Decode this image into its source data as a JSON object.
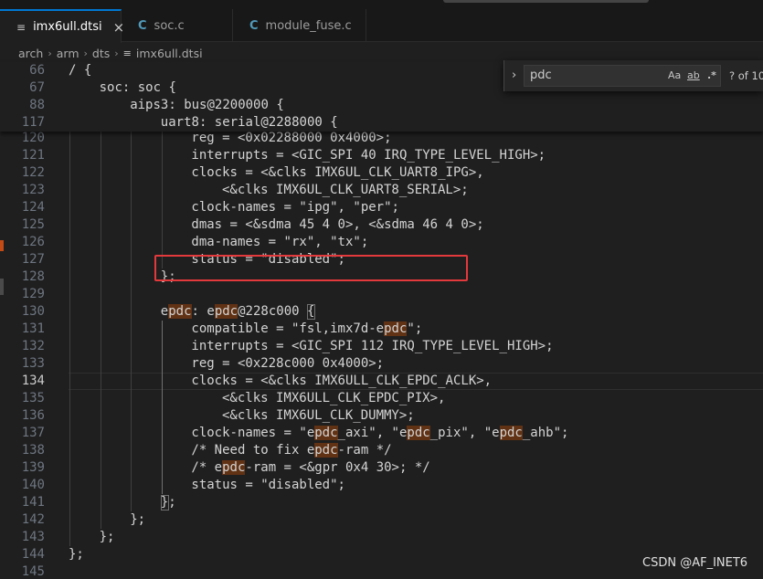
{
  "tabs": [
    {
      "label": "imx6ull.dtsi",
      "icon": "lines-icon",
      "close": "×"
    },
    {
      "label": "soc.c",
      "icon": "c-file-icon"
    },
    {
      "label": "module_fuse.c",
      "icon": "c-file-icon"
    }
  ],
  "tab_icon_c": "C",
  "tab_icon_lines": "≡",
  "breadcrumb": [
    "arch",
    "arm",
    "dts",
    "imx6ull.dtsi"
  ],
  "breadcrumb_sep": "›",
  "find": {
    "toggle": "›",
    "query": "pdc",
    "match_case": "Aa",
    "whole_word": "ab",
    "regex": ".*",
    "count": "? of 10"
  },
  "sticky": [
    {
      "n": "66",
      "indent": 0,
      "text": "/ {"
    },
    {
      "n": "67",
      "indent": 1,
      "text": "soc: soc {"
    },
    {
      "n": "88",
      "indent": 2,
      "text": "aips3: bus@2200000 {"
    },
    {
      "n": "117",
      "indent": 3,
      "text": "uart8: serial@2288000 {"
    }
  ],
  "lines": [
    {
      "n": "120",
      "indent": 4,
      "text": "reg = <0x02288000 0x4000>;"
    },
    {
      "n": "121",
      "indent": 4,
      "text": "interrupts = <GIC_SPI 40 IRQ_TYPE_LEVEL_HIGH>;"
    },
    {
      "n": "122",
      "indent": 4,
      "text": "clocks = <&clks IMX6UL_CLK_UART8_IPG>,"
    },
    {
      "n": "123",
      "indent": 5,
      "text": "<&clks IMX6UL_CLK_UART8_SERIAL>;"
    },
    {
      "n": "124",
      "indent": 4,
      "text": "clock-names = \"ipg\", \"per\";"
    },
    {
      "n": "125",
      "indent": 4,
      "text": "dmas = <&sdma 45 4 0>, <&sdma 46 4 0>;"
    },
    {
      "n": "126",
      "indent": 4,
      "text": "dma-names = \"rx\", \"tx\";"
    },
    {
      "n": "127",
      "indent": 4,
      "text": "status = \"disabled\";"
    },
    {
      "n": "128",
      "indent": 3,
      "text": "};"
    },
    {
      "n": "129",
      "indent": 0,
      "text": ""
    },
    {
      "n": "130",
      "indent": 3,
      "text": "epdc: epdc@228c000 {"
    },
    {
      "n": "131",
      "indent": 4,
      "text": "compatible = \"fsl,imx7d-epdc\";"
    },
    {
      "n": "132",
      "indent": 4,
      "text": "interrupts = <GIC_SPI 112 IRQ_TYPE_LEVEL_HIGH>;"
    },
    {
      "n": "133",
      "indent": 4,
      "text": "reg = <0x228c000 0x4000>;"
    },
    {
      "n": "134",
      "indent": 4,
      "text": "clocks = <&clks IMX6ULL_CLK_EPDC_ACLK>,"
    },
    {
      "n": "135",
      "indent": 5,
      "text": "<&clks IMX6ULL_CLK_EPDC_PIX>,"
    },
    {
      "n": "136",
      "indent": 5,
      "text": "<&clks IMX6UL_CLK_DUMMY>;"
    },
    {
      "n": "137",
      "indent": 4,
      "text": "clock-names = \"epdc_axi\", \"epdc_pix\", \"epdc_ahb\";"
    },
    {
      "n": "138",
      "indent": 4,
      "text": "/* Need to fix epdc-ram */"
    },
    {
      "n": "139",
      "indent": 4,
      "text": "/* epdc-ram = <&gpr 0x4 30>; */"
    },
    {
      "n": "140",
      "indent": 4,
      "text": "status = \"disabled\";"
    },
    {
      "n": "141",
      "indent": 3,
      "text": "};"
    },
    {
      "n": "142",
      "indent": 2,
      "text": "};"
    },
    {
      "n": "143",
      "indent": 1,
      "text": "};"
    },
    {
      "n": "144",
      "indent": 0,
      "text": "};"
    },
    {
      "n": "145",
      "indent": 0,
      "text": ""
    }
  ],
  "current_line": "134",
  "watermark": "CSDN @AF_INET6",
  "colors": {
    "highlight": "#613214",
    "annotation_box": "#e4393c",
    "accent": "#0078d4"
  }
}
